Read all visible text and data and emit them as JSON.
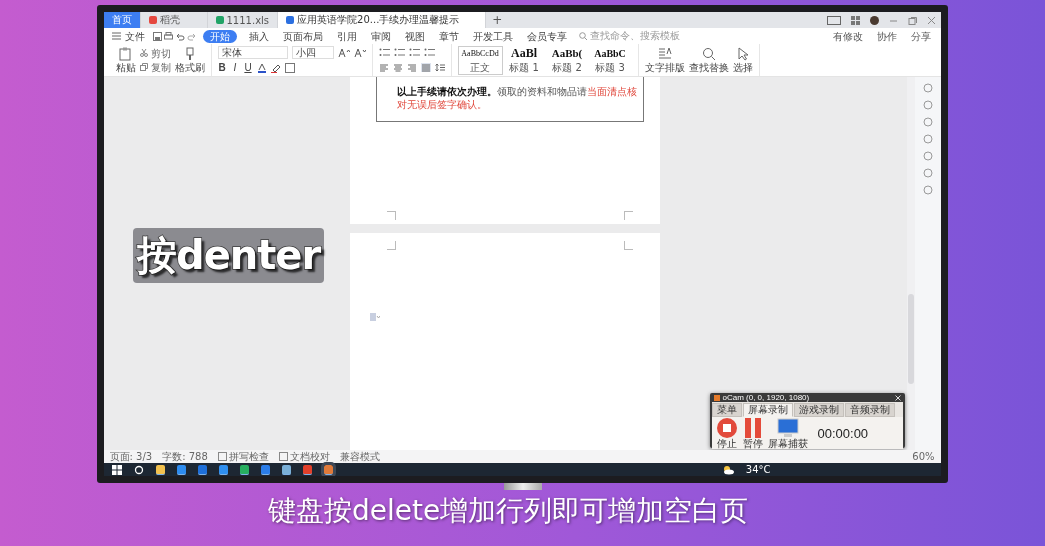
{
  "tabs": [
    {
      "label": "首页",
      "kind": "home",
      "selected": false
    },
    {
      "label": "稻壳",
      "kind": "docer",
      "selected": false
    },
    {
      "label": "1111.xls",
      "kind": "sheet",
      "selected": false
    },
    {
      "label": "应用英语学院20...手续办理温馨提示",
      "kind": "doc",
      "selected": true
    }
  ],
  "new_tab": "+",
  "menu": {
    "file": "文件",
    "items": [
      {
        "label": "开始",
        "selected": true
      },
      {
        "label": "插入",
        "selected": false
      },
      {
        "label": "页面布局",
        "selected": false
      },
      {
        "label": "引用",
        "selected": false
      },
      {
        "label": "审阅",
        "selected": false
      },
      {
        "label": "视图",
        "selected": false
      },
      {
        "label": "章节",
        "selected": false
      },
      {
        "label": "开发工具",
        "selected": false
      },
      {
        "label": "会员专享",
        "selected": false
      }
    ],
    "search_placeholder": "查找命令、搜索模板",
    "right": [
      "有修改",
      "协作",
      "分享"
    ]
  },
  "ribbon": {
    "paste": "粘贴",
    "cut": "剪切",
    "copy": "复制",
    "format_painter": "格式刷",
    "font": "宋体",
    "size": "小四",
    "format_glyphs": [
      "B",
      "I",
      "U"
    ],
    "styles": [
      {
        "preview": "AaBbCcDd",
        "label": "正文",
        "kind": "body"
      },
      {
        "preview": "AaBl",
        "label": "标题 1",
        "kind": "h1"
      },
      {
        "preview": "AaBb(",
        "label": "标题 2",
        "kind": "h2"
      },
      {
        "preview": "AaBbC",
        "label": "标题 3",
        "kind": "h3"
      }
    ],
    "tools": [
      {
        "label": "文字排版",
        "kind": "layout"
      },
      {
        "label": "查找替换",
        "kind": "find"
      },
      {
        "label": "选择",
        "kind": "select"
      }
    ]
  },
  "document": {
    "parts": [
      {
        "text": "以上手续请依次办理。",
        "kind": "bold"
      },
      {
        "text": "领取的资料和物品请",
        "kind": "plain"
      },
      {
        "text": "当面清点核对无误后签字确认。",
        "kind": "warning"
      }
    ]
  },
  "status_bar": {
    "items": [
      {
        "label": "页面: 3/3",
        "kind": "plain"
      },
      {
        "label": "字数: 788",
        "kind": "plain"
      },
      {
        "label": "拼写检查",
        "kind": "check"
      },
      {
        "label": "文档校对",
        "kind": "check"
      },
      {
        "label": "兼容模式",
        "kind": "plain"
      }
    ],
    "zoom": "60%"
  },
  "taskbar": {
    "weather": "34°C"
  },
  "recorder": {
    "title": "oCam (0, 0, 1920, 1080)",
    "tabs": [
      {
        "label": "菜单",
        "selected": false
      },
      {
        "label": "屏幕录制",
        "selected": true
      },
      {
        "label": "游戏录制",
        "selected": false
      },
      {
        "label": "音频录制",
        "selected": false
      }
    ],
    "actions": [
      {
        "label": "停止",
        "kind": "stop"
      },
      {
        "label": "暂停",
        "kind": "pause"
      },
      {
        "label": "屏幕捕获",
        "kind": "capture"
      }
    ],
    "timer": "00:00:00"
  },
  "overlay": {
    "caption": "按denter",
    "subtitle": "键盘按delete增加行列即可增加空白页"
  }
}
